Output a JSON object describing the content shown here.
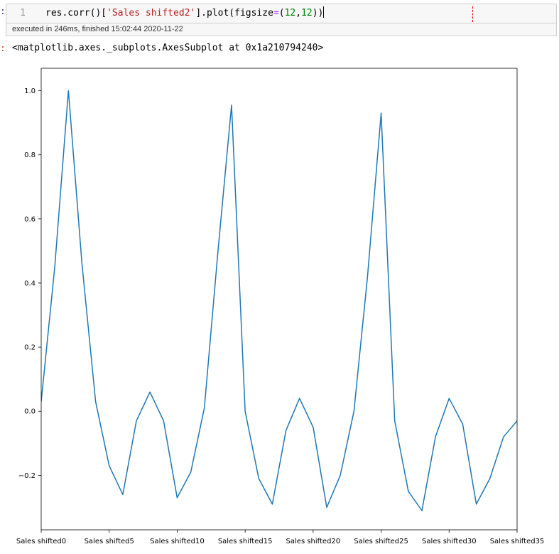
{
  "cell": {
    "prompt": ":",
    "line_number": "1",
    "code_parts": [
      {
        "t": "plain",
        "v": "res.corr()["
      },
      {
        "t": "str",
        "v": "'Sales shifted2'"
      },
      {
        "t": "plain",
        "v": "].plot(figsize"
      },
      {
        "t": "op",
        "v": "="
      },
      {
        "t": "plain",
        "v": "("
      },
      {
        "t": "num",
        "v": "12"
      },
      {
        "t": "plain",
        "v": ","
      },
      {
        "t": "num",
        "v": "12"
      },
      {
        "t": "plain",
        "v": "))"
      }
    ],
    "exec_info": "executed in 246ms, finished 15:02:44 2020-11-22"
  },
  "output": {
    "prompt": ":",
    "text": "<matplotlib.axes._subplots.AxesSubplot at 0x1a210794240>"
  },
  "colors": {
    "line": "#1f77b4",
    "ruler": "#ff0000"
  },
  "chart_data": {
    "type": "line",
    "title": "",
    "xlabel": "",
    "ylabel": "",
    "x_tick_labels": [
      {
        "index": 0,
        "label": "Sales shifted0"
      },
      {
        "index": 5,
        "label": "Sales shifted5"
      },
      {
        "index": 10,
        "label": "Sales shifted10"
      },
      {
        "index": 15,
        "label": "Sales shifted15"
      },
      {
        "index": 20,
        "label": "Sales shifted20"
      },
      {
        "index": 25,
        "label": "Sales shifted25"
      },
      {
        "index": 30,
        "label": "Sales shifted30"
      },
      {
        "index": 35,
        "label": "Sales shifted35"
      }
    ],
    "y_ticks": [
      -0.2,
      0.0,
      0.2,
      0.4,
      0.6,
      0.8,
      1.0
    ],
    "y_tick_labels": [
      "−0.2",
      "0.0",
      "0.2",
      "0.4",
      "0.6",
      "0.8",
      "1.0"
    ],
    "xlim": [
      0,
      35
    ],
    "ylim": [
      -0.37,
      1.07
    ],
    "grid": false,
    "legend": false,
    "series": [
      {
        "values": [
          0.03,
          0.45,
          1.0,
          0.46,
          0.03,
          -0.17,
          -0.26,
          -0.03,
          0.06,
          -0.03,
          -0.27,
          -0.19,
          0.01,
          0.5,
          0.955,
          0.0,
          -0.21,
          -0.29,
          -0.06,
          0.04,
          -0.05,
          -0.3,
          -0.2,
          -0.0,
          0.42,
          0.93,
          -0.03,
          -0.25,
          -0.31,
          -0.08,
          0.04,
          -0.04,
          -0.29,
          -0.21,
          -0.08,
          -0.03
        ]
      }
    ]
  }
}
